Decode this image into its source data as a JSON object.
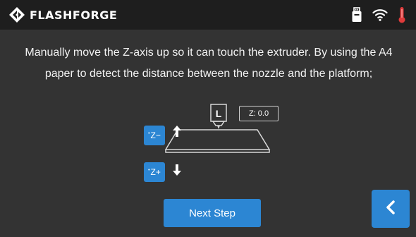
{
  "header": {
    "brand": "FLASHFORGE",
    "brand_logo_icon": "flashforge-logo-icon",
    "status_icons": [
      "usb-drive-icon",
      "wifi-icon",
      "thermometer-icon"
    ],
    "accent_color": "#2c86d3",
    "warning_color": "#e03b3b"
  },
  "main": {
    "instruction": "Manually move the Z-axis up so it can touch the extruder. By using the A4 paper to detect the distance between the nozzle and the platform;",
    "diagram": {
      "nozzle_label": "L",
      "z_readout": "Z: 0.0"
    },
    "z_minus_label": "Z−",
    "z_plus_label": "Z+",
    "z_button_dot": "•"
  },
  "footer": {
    "next_label": "Next Step",
    "back_icon": "chevron-left-icon"
  }
}
